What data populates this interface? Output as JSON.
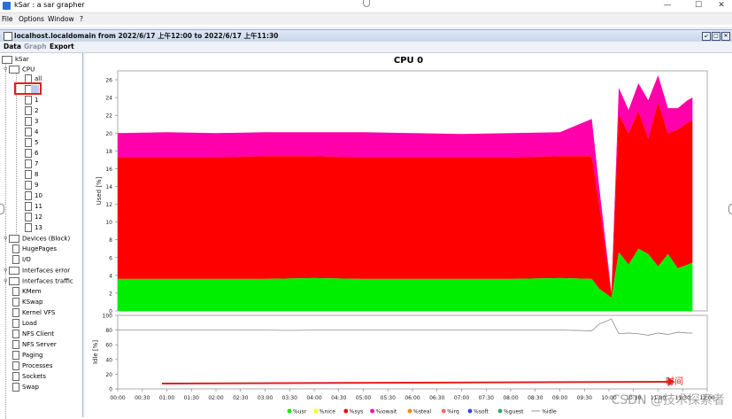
{
  "window": {
    "title": "kSar : a sar grapher",
    "controls": [
      "—",
      "☐",
      "✕"
    ]
  },
  "menubar": {
    "items": [
      "File",
      "Options",
      "Window",
      "?"
    ]
  },
  "inner_window": {
    "title": "localhost.localdomain from 2022/6/17 上午12:00 to 2022/6/17 上午11:30"
  },
  "submenu": {
    "items": [
      "Data",
      "Graph",
      "Export"
    ]
  },
  "tree": {
    "root": "kSar",
    "cpu": "CPU",
    "cpu_children": [
      "all",
      "0",
      "1",
      "2",
      "3",
      "4",
      "5",
      "6",
      "7",
      "8",
      "9",
      "10",
      "11",
      "12",
      "13"
    ],
    "after": [
      {
        "label": "Devices (Block)",
        "folder": true
      },
      {
        "label": "HugePages",
        "folder": false
      },
      {
        "label": "I/O",
        "folder": false
      },
      {
        "label": "Interfaces error",
        "folder": true
      },
      {
        "label": "Interfaces traffic",
        "folder": true
      },
      {
        "label": "KMem",
        "folder": false
      },
      {
        "label": "KSwap",
        "folder": false
      },
      {
        "label": "Kernel VFS",
        "folder": false
      },
      {
        "label": "Load",
        "folder": false
      },
      {
        "label": "NFS Client",
        "folder": false
      },
      {
        "label": "NFS Server",
        "folder": false
      },
      {
        "label": "Paging",
        "folder": false
      },
      {
        "label": "Processes",
        "folder": false
      },
      {
        "label": "Sockets",
        "folder": false
      },
      {
        "label": "Swap",
        "folder": false
      }
    ],
    "selected": "0"
  },
  "chart_data": {
    "type": "area",
    "title": "CPU 0",
    "x": [
      "00:00",
      "00:30",
      "01:00",
      "01:30",
      "02:00",
      "02:30",
      "03:00",
      "03:30",
      "04:00",
      "04:30",
      "05:00",
      "05:30",
      "06:00",
      "06:30",
      "07:00",
      "07:30",
      "08:00",
      "08:30",
      "09:00",
      "09:30",
      "10:00",
      "10:30",
      "11:00",
      "11:30",
      "12:00"
    ],
    "upper": {
      "ylabel": "Used [%]",
      "ylim": [
        0,
        27
      ],
      "yticks": [
        "0",
        "2",
        "4",
        "6",
        "8",
        "10",
        "12",
        "14",
        "16",
        "18",
        "20",
        "22",
        "24",
        "26"
      ],
      "series": [
        {
          "name": "%usr",
          "color": "#00ee00",
          "points": [
            [
              0,
              3.6
            ],
            [
              1.3,
              3.6
            ],
            [
              2,
              3.6
            ],
            [
              4,
              3.6
            ],
            [
              6,
              3.6
            ],
            [
              8,
              3.7
            ],
            [
              10,
              3.6
            ],
            [
              12,
              3.6
            ],
            [
              14,
              3.6
            ],
            [
              16,
              3.6
            ],
            [
              18,
              3.7
            ],
            [
              19.3,
              3.6
            ],
            [
              19.6,
              2.5
            ],
            [
              20.1,
              1.5
            ],
            [
              20.4,
              6.6
            ],
            [
              20.8,
              5.2
            ],
            [
              21.2,
              7
            ],
            [
              21.6,
              6.4
            ],
            [
              22,
              5.0
            ],
            [
              22.4,
              6.4
            ],
            [
              22.8,
              4.8
            ],
            [
              23.2,
              5.2
            ],
            [
              23.4,
              5.4
            ]
          ]
        },
        {
          "name": "%nice",
          "color": "#ffff00",
          "points": [
            [
              0,
              0
            ],
            [
              23.4,
              0
            ]
          ]
        },
        {
          "name": "%sys",
          "color": "#ff0000",
          "points": [
            [
              0,
              13.7
            ],
            [
              2,
              13.7
            ],
            [
              4,
              13.7
            ],
            [
              6,
              13.8
            ],
            [
              7,
              13.9
            ],
            [
              8,
              13.7
            ],
            [
              10,
              13.7
            ],
            [
              12,
              13.7
            ],
            [
              14,
              13.7
            ],
            [
              16,
              13.7
            ],
            [
              18,
              13.7
            ],
            [
              19.3,
              13.8
            ],
            [
              19.6,
              9.5
            ],
            [
              20.1,
              0.5
            ],
            [
              20.4,
              15.5
            ],
            [
              20.8,
              14.8
            ],
            [
              21.2,
              15.5
            ],
            [
              21.6,
              13.0
            ],
            [
              22,
              18.5
            ],
            [
              22.4,
              13.6
            ],
            [
              22.8,
              15.6
            ],
            [
              23.2,
              16.0
            ],
            [
              23.4,
              16.0
            ]
          ]
        },
        {
          "name": "%iowait",
          "color": "#ff00aa",
          "points": [
            [
              0,
              2.7
            ],
            [
              2,
              2.8
            ],
            [
              4,
              2.7
            ],
            [
              6,
              2.7
            ],
            [
              7,
              2.8
            ],
            [
              8,
              2.7
            ],
            [
              10,
              2.8
            ],
            [
              12,
              2.7
            ],
            [
              14,
              2.6
            ],
            [
              16,
              2.7
            ],
            [
              18,
              2.7
            ],
            [
              19.3,
              4.2
            ],
            [
              19.6,
              2.0
            ],
            [
              20.1,
              0.1
            ],
            [
              20.4,
              3.0
            ],
            [
              20.8,
              2.6
            ],
            [
              21.2,
              3.1
            ],
            [
              21.6,
              4.3
            ],
            [
              22,
              3.0
            ],
            [
              22.4,
              2.8
            ],
            [
              22.8,
              2.4
            ],
            [
              23.2,
              2.5
            ],
            [
              23.4,
              2.6
            ]
          ]
        },
        {
          "name": "%steal",
          "color": "#ff8800"
        },
        {
          "name": "%irq",
          "color": "#ff6666"
        },
        {
          "name": "%soft",
          "color": "#3344ee"
        },
        {
          "name": "%guest",
          "color": "#33aa66"
        }
      ]
    },
    "lower": {
      "ylabel": "Idle [%]",
      "ylim": [
        0,
        100
      ],
      "yticks": [
        "0",
        "20",
        "40",
        "60",
        "80",
        "100"
      ],
      "series": [
        {
          "name": "%idle",
          "color": "#999999",
          "points": [
            [
              0,
              80
            ],
            [
              2,
              80
            ],
            [
              4,
              80
            ],
            [
              6,
              80
            ],
            [
              7,
              79.5
            ],
            [
              8,
              80
            ],
            [
              10,
              80
            ],
            [
              12,
              80
            ],
            [
              14,
              80
            ],
            [
              16,
              80
            ],
            [
              18,
              80
            ],
            [
              19.3,
              79
            ],
            [
              19.6,
              88
            ],
            [
              20.1,
              95
            ],
            [
              20.4,
              75
            ],
            [
              20.8,
              76
            ],
            [
              21.2,
              75
            ],
            [
              21.6,
              73
            ],
            [
              22,
              76
            ],
            [
              22.4,
              74
            ],
            [
              22.8,
              77
            ],
            [
              23.2,
              76
            ],
            [
              23.4,
              76
            ]
          ]
        }
      ]
    },
    "annotation": {
      "text": "时间",
      "color": "#e0201f"
    }
  },
  "watermark": "CSDN @技术探索者"
}
